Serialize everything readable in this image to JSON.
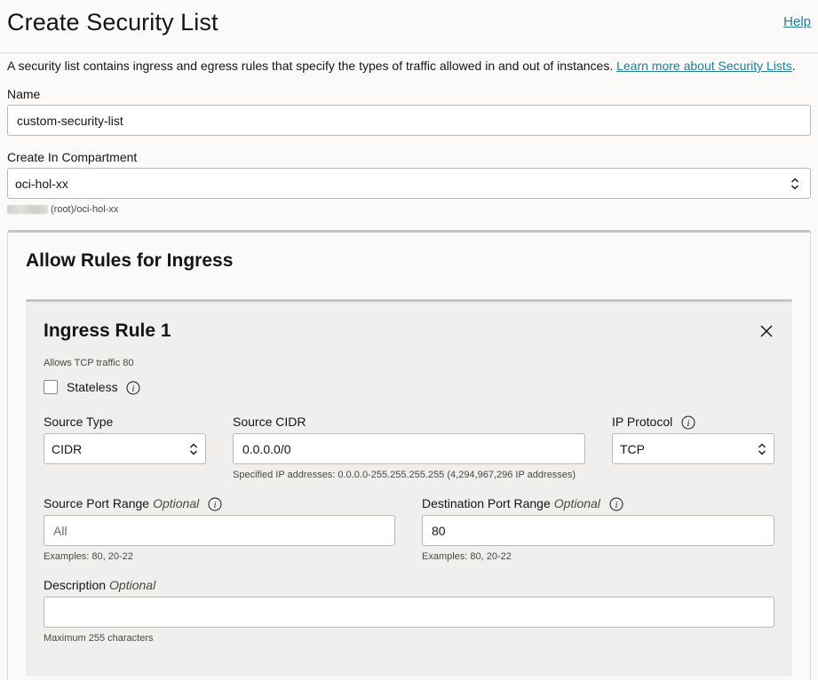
{
  "header": {
    "title": "Create Security List",
    "help_label": "Help"
  },
  "intro": {
    "text": "A security list contains ingress and egress rules that specify the types of traffic allowed in and out of instances. ",
    "link_label": "Learn more about Security Lists",
    "trailing": "."
  },
  "name_field": {
    "label": "Name",
    "value": "custom-security-list"
  },
  "compartment": {
    "label": "Create In Compartment",
    "value": "oci-hol-xx",
    "path_hint": "(root)/oci-hol-xx"
  },
  "ingress": {
    "section_title": "Allow Rules for Ingress",
    "rule": {
      "title": "Ingress Rule 1",
      "description_hint": "Allows TCP traffic 80",
      "stateless_label": "Stateless",
      "stateless_checked": false,
      "source_type": {
        "label": "Source Type",
        "value": "CIDR"
      },
      "source_cidr": {
        "label": "Source CIDR",
        "value": "0.0.0.0/0",
        "hint": "Specified IP addresses: 0.0.0.0-255.255.255.255 (4,294,967,296 IP addresses)"
      },
      "ip_protocol": {
        "label": "IP Protocol",
        "value": "TCP"
      },
      "source_port_range": {
        "label": "Source Port Range",
        "optional": "Optional",
        "placeholder": "All",
        "value": "",
        "hint": "Examples: 80, 20-22"
      },
      "destination_port_range": {
        "label": "Destination Port Range",
        "optional": "Optional",
        "value": "80",
        "hint": "Examples: 80, 20-22"
      },
      "description": {
        "label": "Description",
        "optional": "Optional",
        "value": "",
        "hint": "Maximum 255 characters"
      }
    }
  },
  "colors": {
    "link": "#227e9e",
    "text": "#161513",
    "card_bg": "#f1efed",
    "page_bg": "#fbfaf9"
  }
}
